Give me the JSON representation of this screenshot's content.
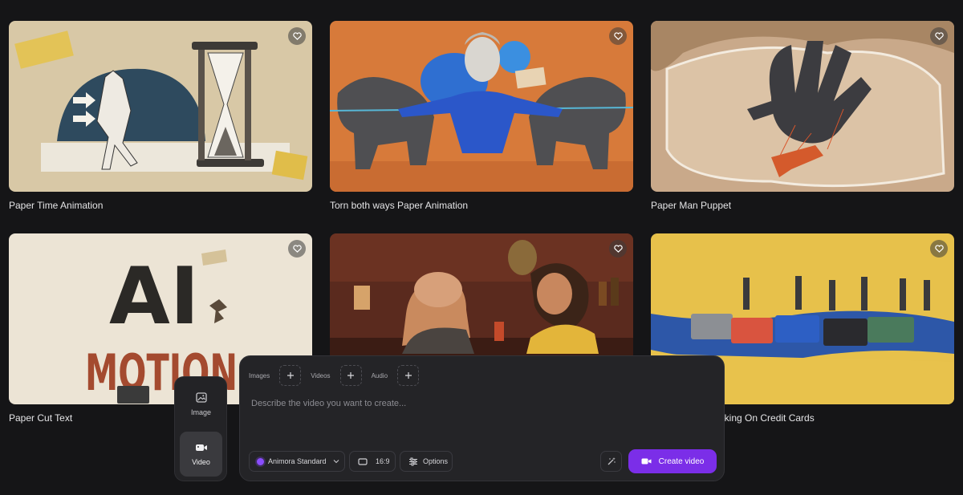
{
  "gallery": {
    "cards": [
      {
        "title": "Paper Time Animation"
      },
      {
        "title": "Torn both ways Paper Animation"
      },
      {
        "title": "Paper Man Puppet"
      },
      {
        "title": "Paper Cut Text"
      },
      {
        "title": ""
      },
      {
        "title": "lking On Credit Cards"
      }
    ],
    "art_texts": {
      "ai": "AI",
      "motion": "MOTION"
    }
  },
  "mode_switcher": {
    "items": [
      {
        "label": "Image",
        "icon": "image-icon",
        "active": false
      },
      {
        "label": "Video",
        "icon": "video-icon",
        "active": true
      }
    ]
  },
  "composer": {
    "attachments": [
      {
        "label": "Images"
      },
      {
        "label": "Videos"
      },
      {
        "label": "Audio"
      }
    ],
    "prompt_placeholder": "Describe the video you want to create...",
    "prompt_value": "",
    "model": "Animora Standard",
    "aspect_ratio": "16:9",
    "options_label": "Options",
    "create_label": "Create video"
  },
  "colors": {
    "accent": "#7b2ee8",
    "background": "#151517",
    "panel": "#242427"
  }
}
